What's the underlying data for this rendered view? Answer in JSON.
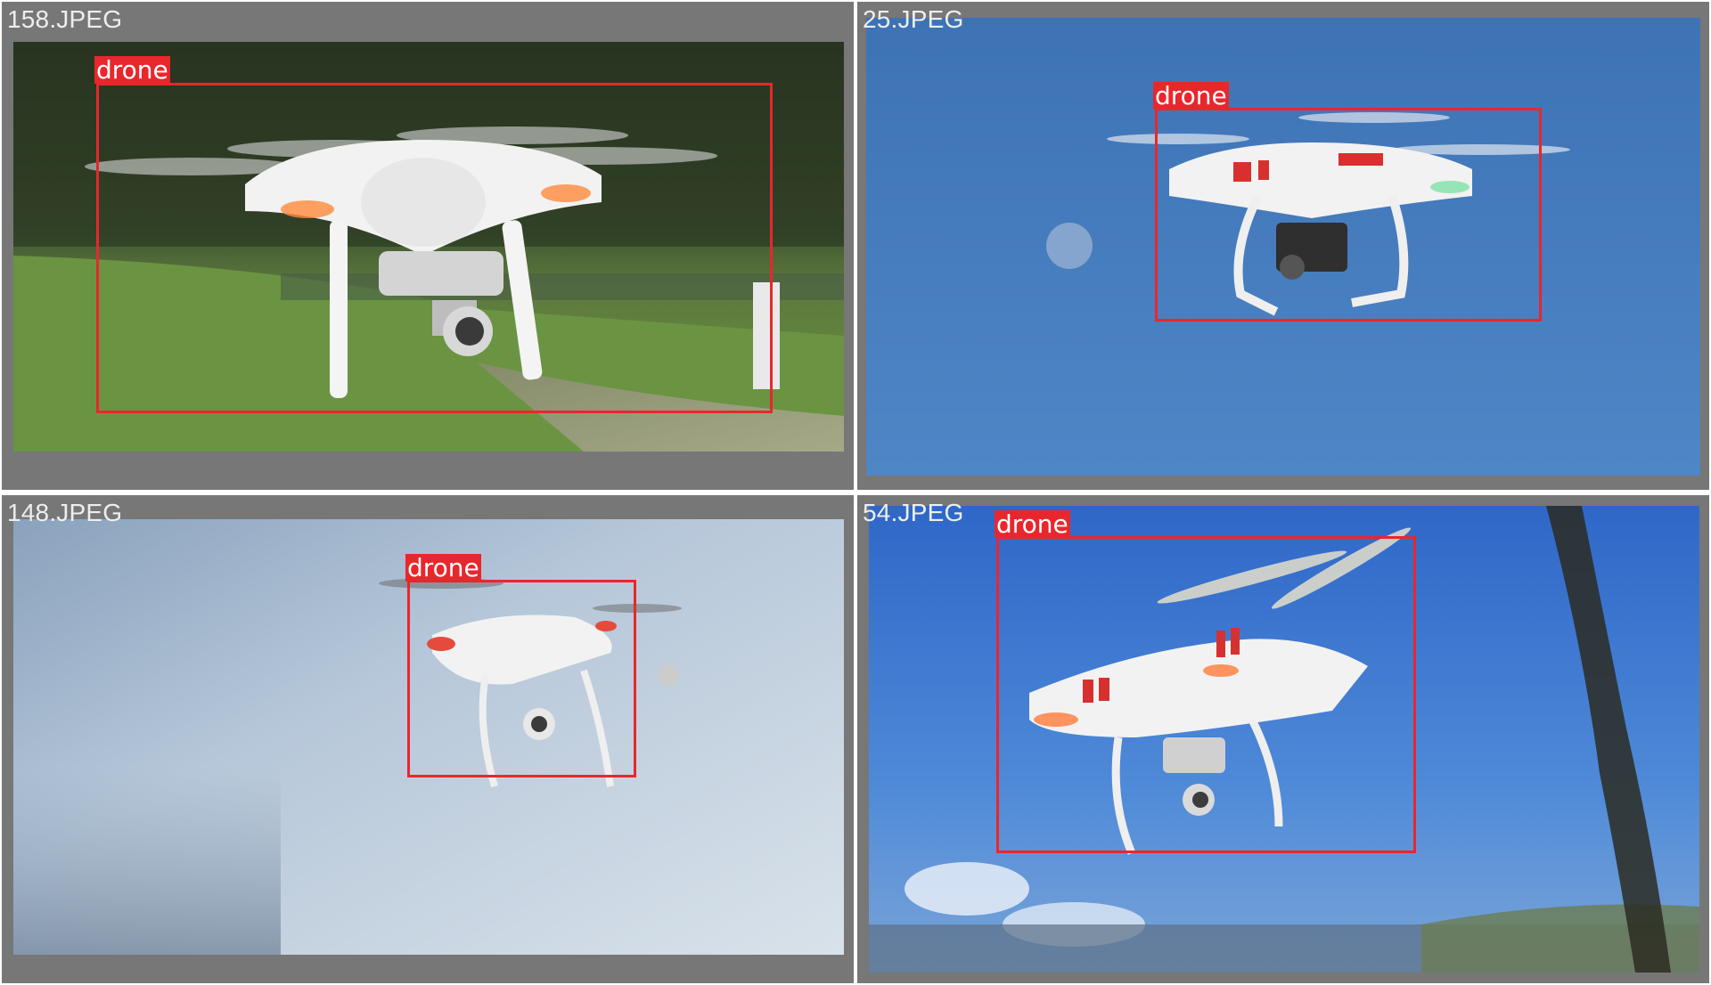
{
  "images": [
    {
      "filename": "158.JPEG",
      "detections": [
        {
          "label": "drone"
        }
      ]
    },
    {
      "filename": "25.JPEG",
      "detections": [
        {
          "label": "drone"
        }
      ]
    },
    {
      "filename": "148.JPEG",
      "detections": [
        {
          "label": "drone"
        }
      ]
    },
    {
      "filename": "54.JPEG",
      "detections": [
        {
          "label": "drone"
        }
      ]
    }
  ],
  "colors": {
    "panel_bg": "#777777",
    "box": "#e8272c",
    "label_text": "#ffffff"
  }
}
